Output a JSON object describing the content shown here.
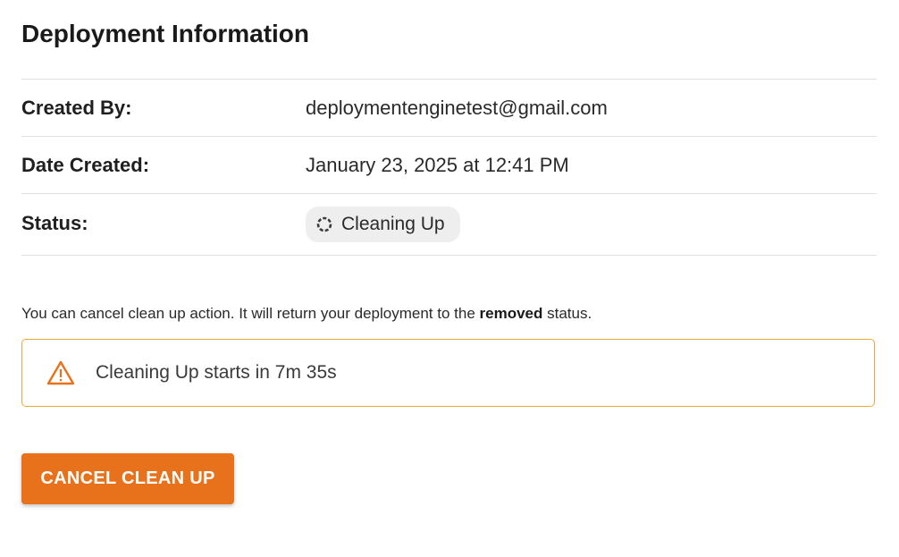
{
  "section": {
    "title": "Deployment Information"
  },
  "info": {
    "created_by_label": "Created By:",
    "created_by_value": "deploymentenginetest@gmail.com",
    "date_created_label": "Date Created:",
    "date_created_value": "January 23, 2025 at 12:41 PM",
    "status_label": "Status:",
    "status_value": "Cleaning Up",
    "status_icon": "spinner-icon"
  },
  "note": {
    "prefix": "You can cancel clean up action. It will return your deployment to the ",
    "emphasis": "removed",
    "suffix": " status."
  },
  "alert": {
    "icon": "warning-icon",
    "text": "Cleaning Up starts in 7m 35s",
    "border_color": "#f0a73a",
    "icon_color": "#e8711b"
  },
  "actions": {
    "cancel_label": "CANCEL CLEAN UP",
    "button_color": "#e8711b"
  }
}
